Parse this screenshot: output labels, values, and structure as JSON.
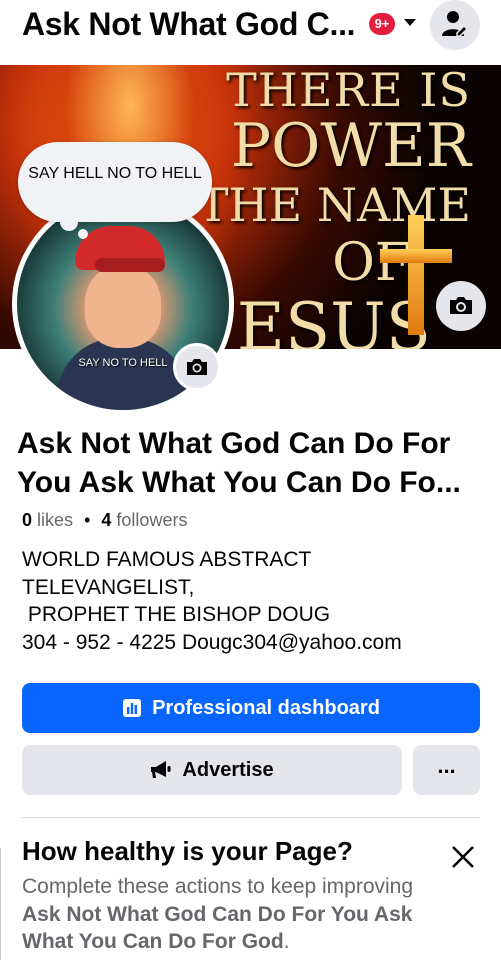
{
  "header": {
    "page_name": "Ask Not What God C...",
    "notification_count": "9+"
  },
  "cover": {
    "lines": [
      "THERE IS",
      "POWER",
      "N THE NAME",
      "OF",
      "ESUS"
    ]
  },
  "speech_bubble": {
    "text": "SAY HELL NO TO HELL"
  },
  "avatar": {
    "caption": "SAY NO TO HELL"
  },
  "page": {
    "title": "Ask Not What God Can Do For You Ask What You Can Do Fo...",
    "likes_count": "0",
    "likes_label": "likes",
    "separator": "•",
    "followers_count": "4",
    "followers_label": "followers",
    "bio": "WORLD FAMOUS ABSTRACT\nTELEVANGELIST,\n PROPHET THE BISHOP DOUG\n304 - 952 - 4225 Dougc304@yahoo.com"
  },
  "buttons": {
    "professional_dashboard": "Professional dashboard",
    "advertise": "Advertise",
    "more": "..."
  },
  "health_card": {
    "title": "How healthy is your Page?",
    "desc_prefix": "Complete these actions to keep improving ",
    "desc_page": "Ask Not What God Can Do For You Ask What You Can Do For God",
    "desc_suffix": "."
  },
  "icons": [
    "profile-switch-icon",
    "caret-down-icon",
    "camera-icon",
    "dashboard-chart-icon",
    "megaphone-icon",
    "close-icon"
  ],
  "colors": {
    "primary_blue": "#0866ff",
    "badge_red": "#e41e3f",
    "button_gray": "#e4e6eb",
    "secondary_text": "#65676b"
  }
}
